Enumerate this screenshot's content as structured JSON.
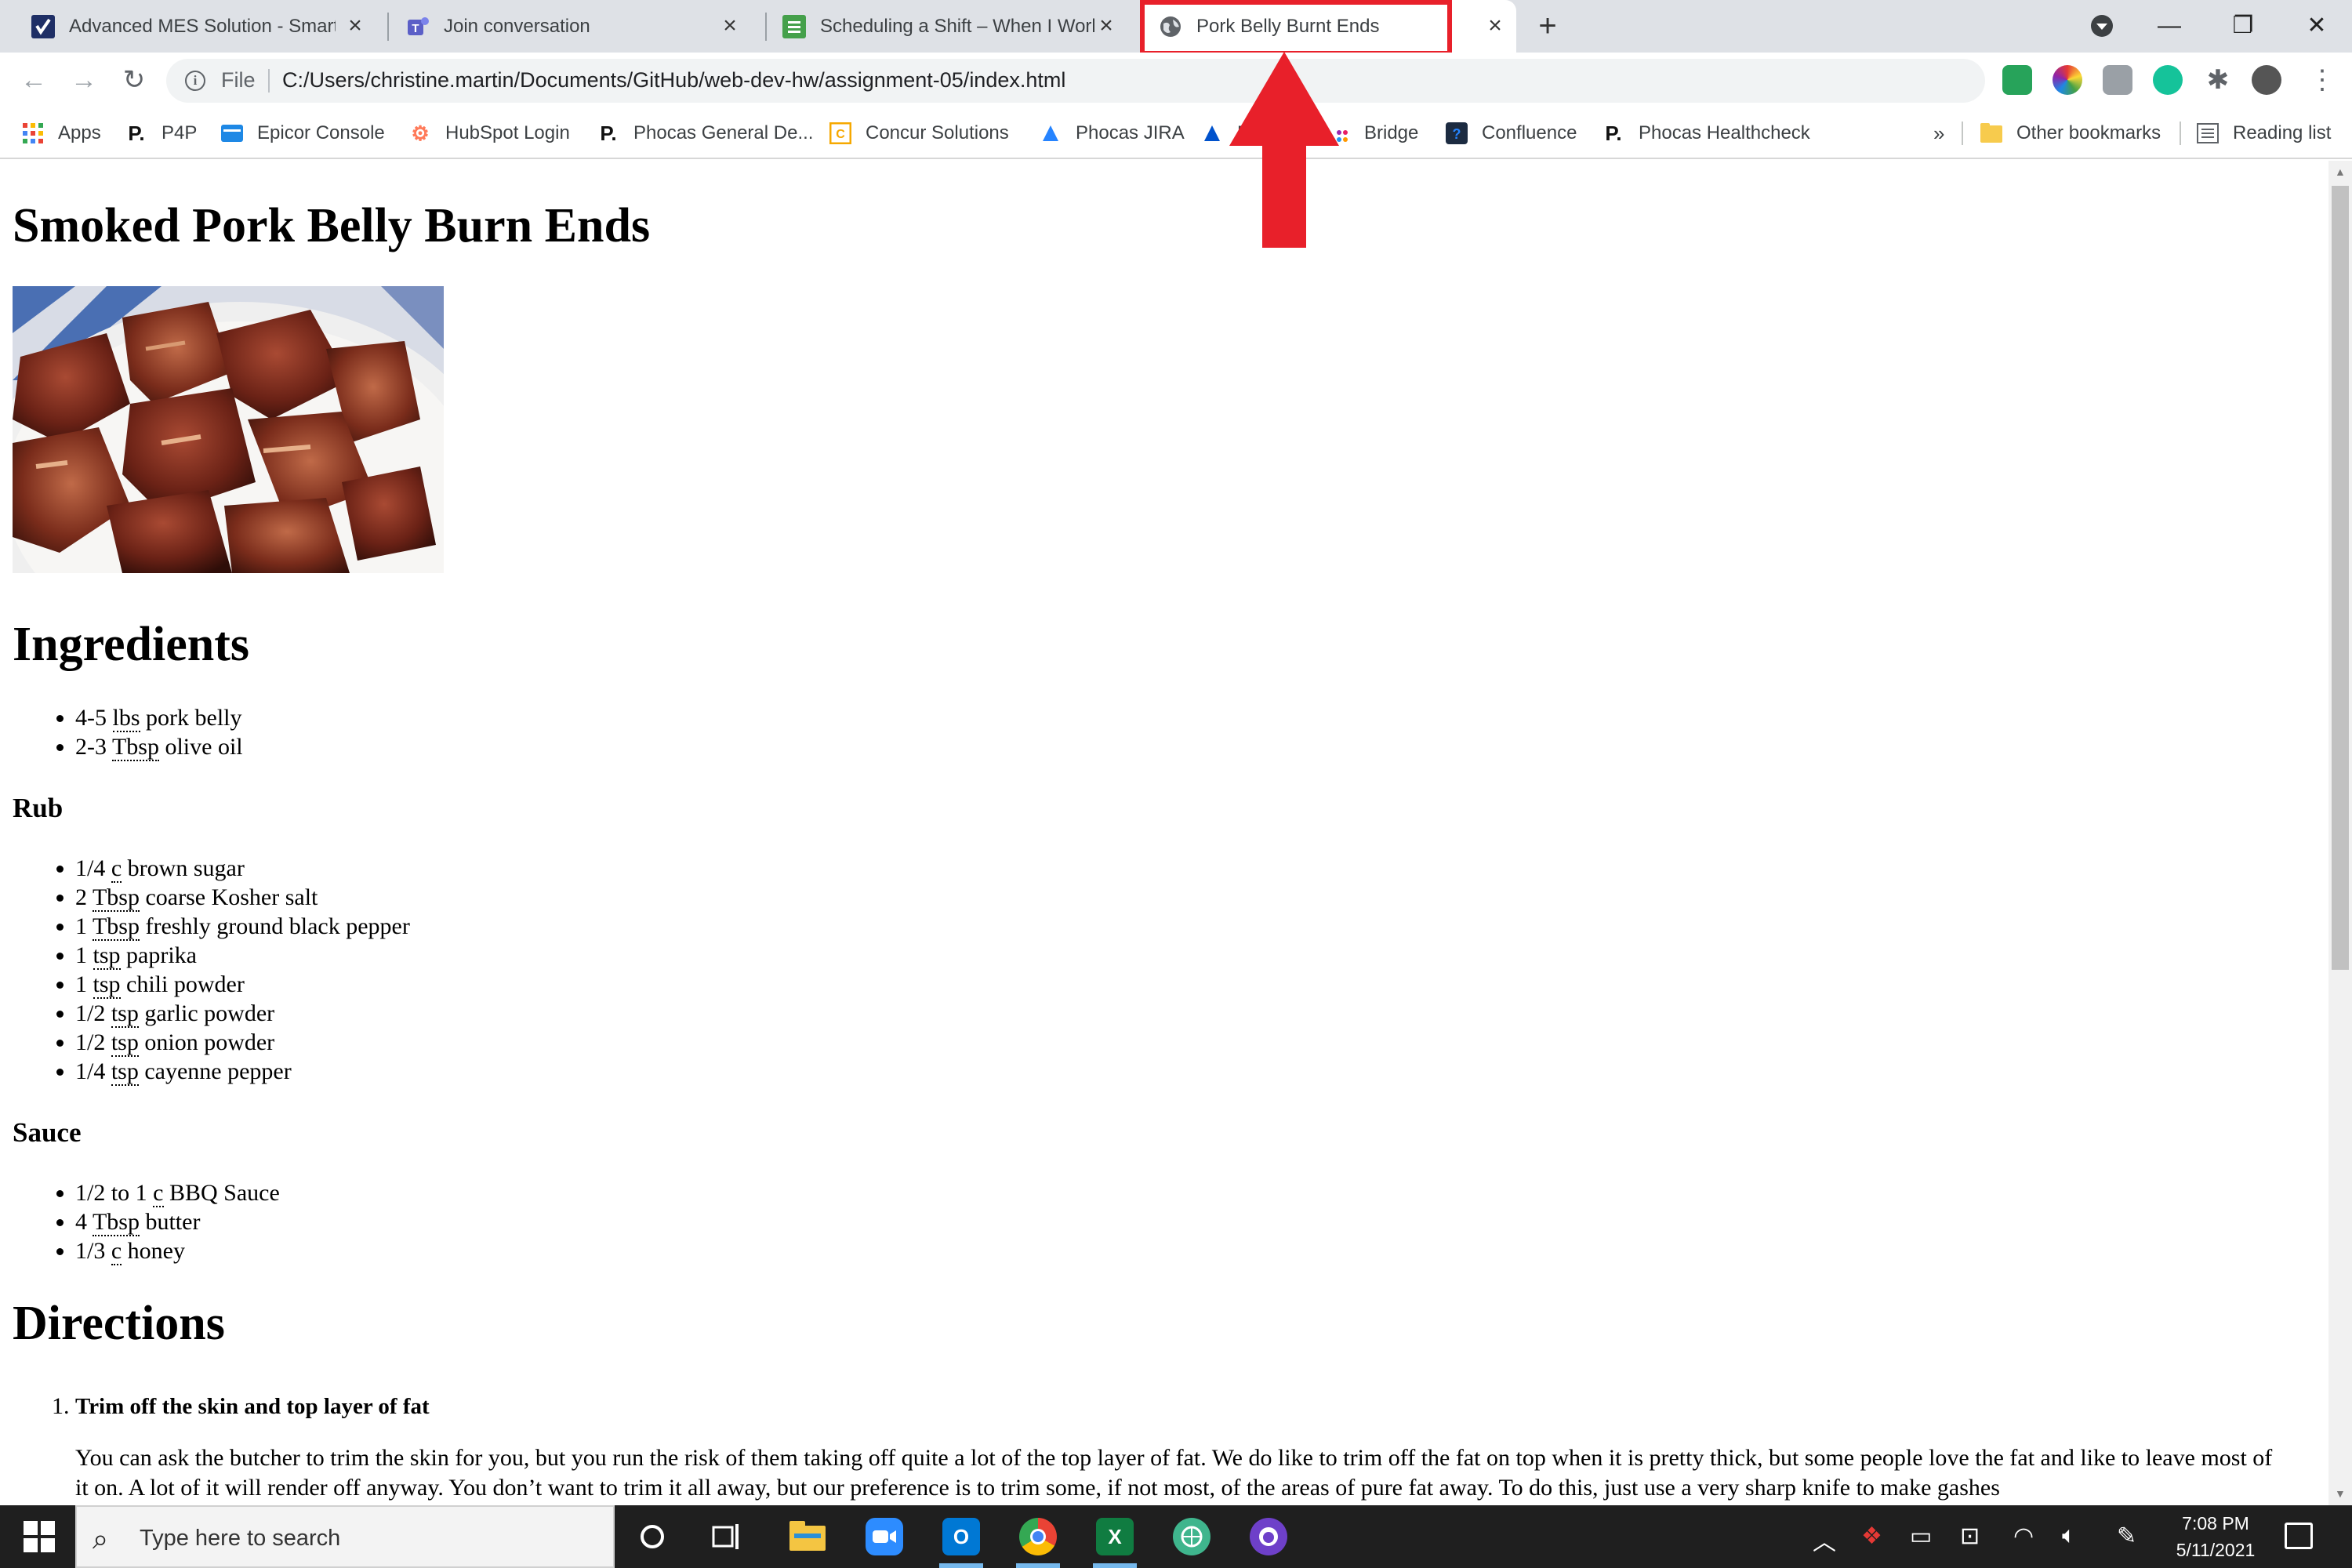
{
  "tabs": [
    {
      "title": "Advanced MES Solution - Smartsheet",
      "icon": "smartsheet-icon",
      "color": "#1f2f66"
    },
    {
      "title": "Join conversation",
      "icon": "teams-icon",
      "color": "#5b5fc7"
    },
    {
      "title": "Scheduling a Shift – When I Work",
      "icon": "wheniwork-icon",
      "color": "#45a04b"
    },
    {
      "title": "Pork Belly Burnt Ends",
      "icon": "globe-icon",
      "color": "#5f6368"
    }
  ],
  "new_tab": "+",
  "window_controls": {
    "minimize": "—",
    "restore": "❐",
    "close": "✕"
  },
  "address_bar": {
    "scheme_label": "File",
    "url": "C:/Users/christine.martin/Documents/GitHub/web-dev-hw/assignment-05/index.html"
  },
  "bookmarks": [
    {
      "label": "Apps",
      "icon": "apps-grid-icon"
    },
    {
      "label": "P4P",
      "icon": "phocas-icon"
    },
    {
      "label": "Epicor Console",
      "icon": "epicor-icon"
    },
    {
      "label": "HubSpot Login",
      "icon": "hubspot-icon"
    },
    {
      "label": "Phocas General De...",
      "icon": "phocas-icon"
    },
    {
      "label": "Concur Solutions",
      "icon": "concur-icon"
    },
    {
      "label": "Phocas JIRA",
      "icon": "jira-icon"
    },
    {
      "label": "N",
      "icon": "jira-icon"
    },
    {
      "label": "Bridge",
      "icon": "bridge-icon"
    },
    {
      "label": "Confluence",
      "icon": "confluence-icon"
    },
    {
      "label": "Phocas Healthcheck",
      "icon": "phocas-icon"
    }
  ],
  "bookmarks_overflow": "»",
  "other_bookmarks": "Other bookmarks",
  "reading_list": "Reading list",
  "page": {
    "title": "Smoked Pork Belly Burn Ends",
    "ingredients_heading": "Ingredients",
    "ingredients": [
      {
        "qty": "4-5",
        "unit": "lbs",
        "item": "pork belly"
      },
      {
        "qty": "2-3",
        "unit": "Tbsp",
        "item": "olive oil"
      }
    ],
    "rub_heading": "Rub",
    "rub": [
      {
        "qty": "1/4",
        "unit": "c",
        "item": "brown sugar"
      },
      {
        "qty": "2",
        "unit": "Tbsp",
        "item": "coarse Kosher salt"
      },
      {
        "qty": "1",
        "unit": "Tbsp",
        "item": "freshly ground black pepper"
      },
      {
        "qty": "1",
        "unit": "tsp",
        "item": "paprika"
      },
      {
        "qty": "1",
        "unit": "tsp",
        "item": "chili powder"
      },
      {
        "qty": "1/2",
        "unit": "tsp",
        "item": "garlic powder"
      },
      {
        "qty": "1/2",
        "unit": "tsp",
        "item": "onion powder"
      },
      {
        "qty": "1/4",
        "unit": "tsp",
        "item": "cayenne pepper"
      }
    ],
    "sauce_heading": "Sauce",
    "sauce": [
      {
        "qty": "1/2 to 1",
        "unit": "c",
        "item": "BBQ Sauce"
      },
      {
        "qty": "4",
        "unit": "Tbsp",
        "item": "butter"
      },
      {
        "qty": "1/3",
        "unit": "c",
        "item": "honey"
      }
    ],
    "directions_heading": "Directions",
    "step1_title": "Trim off the skin and top layer of fat",
    "step1_body": "You can ask the butcher to trim the skin for you, but you run the risk of them taking off quite a lot of the top layer of fat. We do like to trim off the fat on top when it is pretty thick, but some people love the fat and like to leave most of it on. A lot of it will render off anyway. You don’t want to trim it all away, but our preference is to trim some, if not most, of the areas of pure fat away. To do this, just use a very sharp knife to make gashes"
  },
  "taskbar": {
    "search_placeholder": "Type here to search",
    "time": "7:08 PM",
    "date": "5/11/2021"
  },
  "colors": {
    "annotation_red": "#e8202a",
    "tabstrip": "#dee1e6",
    "taskbar": "#1f1f1f"
  }
}
